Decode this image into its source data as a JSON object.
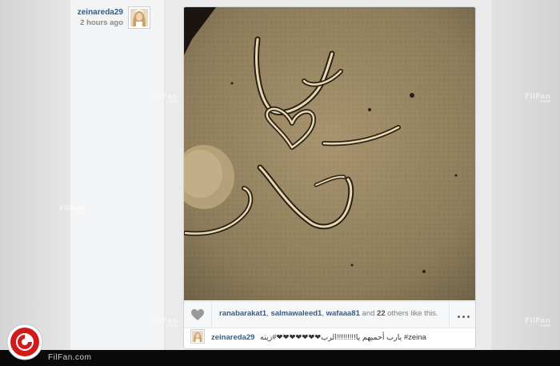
{
  "post": {
    "username": "zeinareda29",
    "time_ago": "2 hours ago"
  },
  "likes": {
    "users": [
      "ranabarakat1",
      "salmawaleed1",
      "wafaaa81"
    ],
    "sep": ",",
    "and_text": "and",
    "others_count": "22",
    "others_text": "others like this."
  },
  "caption": {
    "username": "zeinareda29",
    "text": "يارب أحميهم يا!!!!!!!!!الرب❤❤❤❤❤❤❤#زينه #zeina"
  },
  "watermark": {
    "text": "FilFan",
    "sub": ".com"
  },
  "footer": {
    "site_text": "FilFan.com"
  },
  "icons": [
    "heart-icon",
    "more-options-icon",
    "filfan-logo-icon"
  ],
  "colors": {
    "link": "#2d5f8f",
    "logo_red": "#d11a1a",
    "footer_bg": "#0a0a0a"
  }
}
